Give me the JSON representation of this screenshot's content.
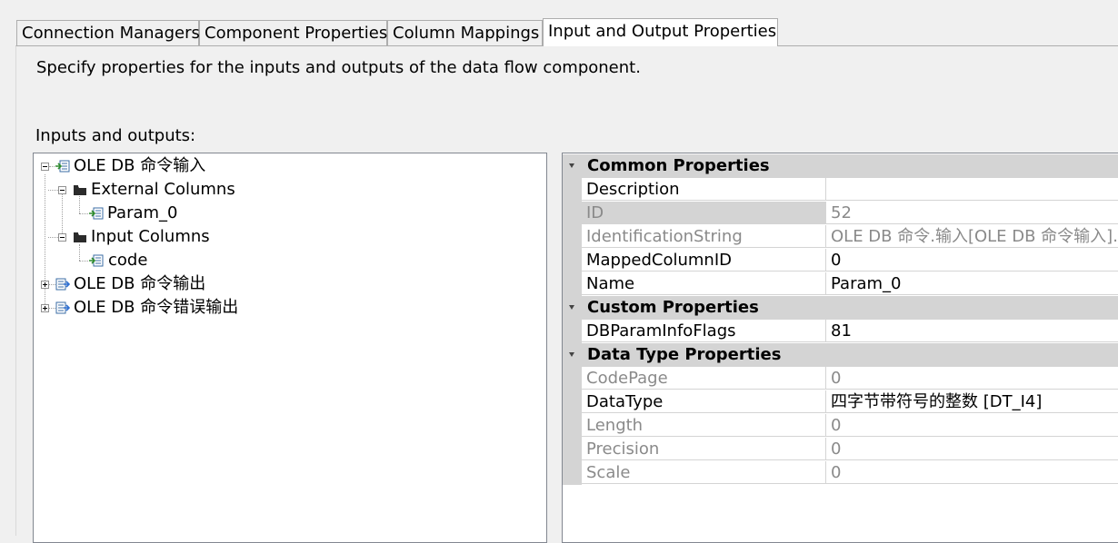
{
  "tabs": [
    {
      "label": "Connection Managers",
      "active": false
    },
    {
      "label": "Component Properties",
      "active": false
    },
    {
      "label": "Column Mappings",
      "active": false
    },
    {
      "label": "Input and Output Properties",
      "active": true
    }
  ],
  "description": "Specify properties for the inputs and outputs of the data flow component.",
  "io_label": "Inputs and outputs:",
  "tree": {
    "input": "OLE DB 命令输入",
    "external_columns": "External Columns",
    "param": "Param_0",
    "input_columns": "Input Columns",
    "code": "code",
    "output": "OLE DB 命令输出",
    "error_output": "OLE DB 命令错误输出"
  },
  "properties": {
    "common": {
      "title": "Common Properties",
      "rows": [
        {
          "name": "Description",
          "value": ""
        },
        {
          "name": "ID",
          "value": "52"
        },
        {
          "name": "IdentificationString",
          "value": "OLE DB 命令.输入[OLE DB 命令输入].E"
        },
        {
          "name": "MappedColumnID",
          "value": "0"
        },
        {
          "name": "Name",
          "value": "Param_0"
        }
      ]
    },
    "custom": {
      "title": "Custom Properties",
      "rows": [
        {
          "name": "DBParamInfoFlags",
          "value": "81"
        }
      ]
    },
    "datatype": {
      "title": "Data Type Properties",
      "rows": [
        {
          "name": "CodePage",
          "value": "0"
        },
        {
          "name": "DataType",
          "value": "四字节带符号的整数 [DT_I4]"
        },
        {
          "name": "Length",
          "value": "0"
        },
        {
          "name": "Precision",
          "value": "0"
        },
        {
          "name": "Scale",
          "value": "0"
        }
      ]
    }
  },
  "colors": {
    "category_bg": "#d4d4d4",
    "readonly_text": "#8a8a8a",
    "border": "#828790"
  }
}
